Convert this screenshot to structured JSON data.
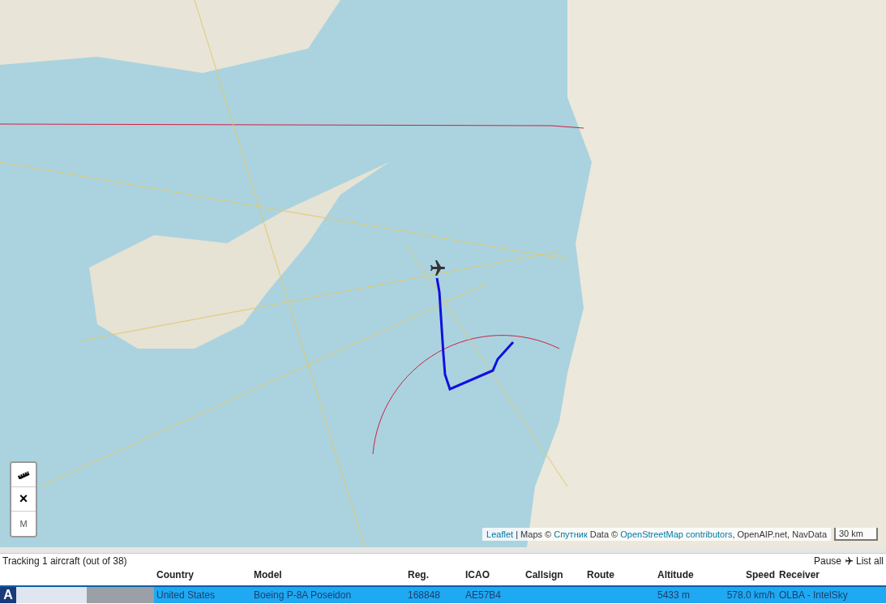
{
  "map": {
    "controls": [
      {
        "kind": "ruler"
      },
      {
        "kind": "close",
        "label": "×"
      },
      {
        "kind": "text",
        "label": "M"
      }
    ],
    "attribution": [
      {
        "text": "Leaflet",
        "kind": "link"
      },
      {
        "text": " | Maps © ",
        "kind": "text"
      },
      {
        "text": "Спутник",
        "kind": "link"
      },
      {
        "text": " Data © ",
        "kind": "text"
      },
      {
        "text": "OpenStreetMap contributors",
        "kind": "link"
      },
      {
        "text": ", OpenAIP.net, NavData",
        "kind": "text"
      }
    ],
    "scale": "30 km"
  },
  "status": "Tracking 1 aircraft (out of 38)",
  "actions": [
    "Pause",
    "List all"
  ],
  "table": {
    "columns": [
      "Country",
      "Model",
      "Reg.",
      "ICAO",
      "Callsign",
      "Route",
      "Altitude",
      "Speed",
      "Receiver"
    ],
    "rows": [
      {
        "badge": "A",
        "selected": true,
        "cells": [
          "United States",
          "Boeing P-8A Poseidon",
          "168848",
          "AE57B4",
          "",
          "",
          "5433 m",
          "578.0 km/h",
          "OLBA - IntelSky"
        ]
      }
    ]
  }
}
